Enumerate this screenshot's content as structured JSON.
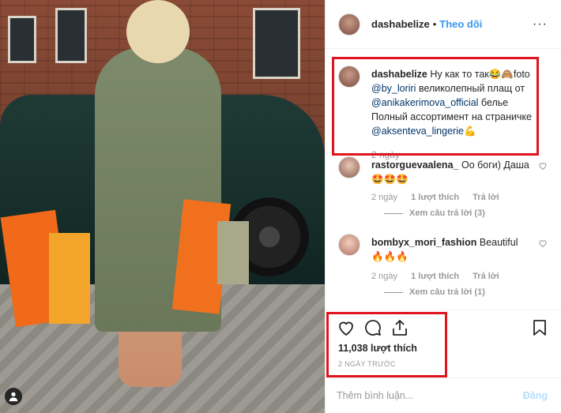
{
  "header": {
    "username": "dashabelize",
    "separator": "•",
    "follow_label": "Theo dõi",
    "more_label": "···"
  },
  "caption": {
    "username": "dashabelize",
    "text_part1": "Ну как то так😂🙈foto",
    "mention1": "@by_loriri",
    "text_part2": "великолепный плащ от",
    "mention2": "@anikakerimova_official",
    "text_part3": "белье Полный ассортимент на страничке",
    "mention3": "@aksenteva_lingerie",
    "emoji_end": "💪",
    "time": "2 ngày"
  },
  "comments": [
    {
      "username": "rastorguevaalena_",
      "text": "Оо боги) Даша 🤩🤩🤩",
      "time": "2 ngày",
      "likes": "1 lượt thích",
      "reply": "Trả lời",
      "view_replies": "Xem câu trả lời (3)"
    },
    {
      "username": "bombyx_mori_fashion",
      "text": "Beautiful 🔥🔥🔥",
      "time": "2 ngày",
      "likes": "1 lượt thích",
      "reply": "Trả lời",
      "view_replies": "Xem câu trả lời (1)"
    }
  ],
  "actions": {
    "like_icon": "heart-icon",
    "comment_icon": "comment-icon",
    "share_icon": "share-icon",
    "save_icon": "bookmark-icon"
  },
  "likes_count": "11,038 lượt thích",
  "posted_ago": "2 NGÀY TRƯỚC",
  "comment_input": {
    "placeholder": "Thêm bình luận...",
    "post_label": "Đăng"
  },
  "colors": {
    "accent": "#3897f0",
    "highlight_box": "#e0141e",
    "post_disabled": "#b2dffc"
  }
}
